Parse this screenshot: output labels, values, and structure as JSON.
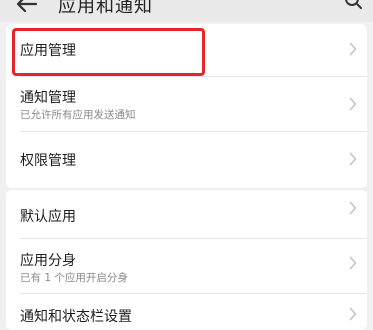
{
  "header": {
    "title": "应用和通知",
    "back_icon": "back-arrow-icon",
    "search_icon": "search-icon"
  },
  "settings": [
    {
      "title": "应用管理",
      "subtitle": ""
    },
    {
      "title": "通知管理",
      "subtitle": "已允许所有应用发送通知"
    },
    {
      "title": "权限管理",
      "subtitle": ""
    },
    {
      "title": "默认应用",
      "subtitle": ""
    },
    {
      "title": "应用分身",
      "subtitle": "已有 1 个应用开启分身"
    },
    {
      "title": "通知和状态栏设置",
      "subtitle": ""
    }
  ],
  "annotation": {
    "highlight_color": "#e4262c"
  },
  "colors": {
    "background": "#f0f0f0",
    "card": "#ffffff",
    "primary_text": "#1e1e1e",
    "secondary_text": "#8a8a8a"
  }
}
